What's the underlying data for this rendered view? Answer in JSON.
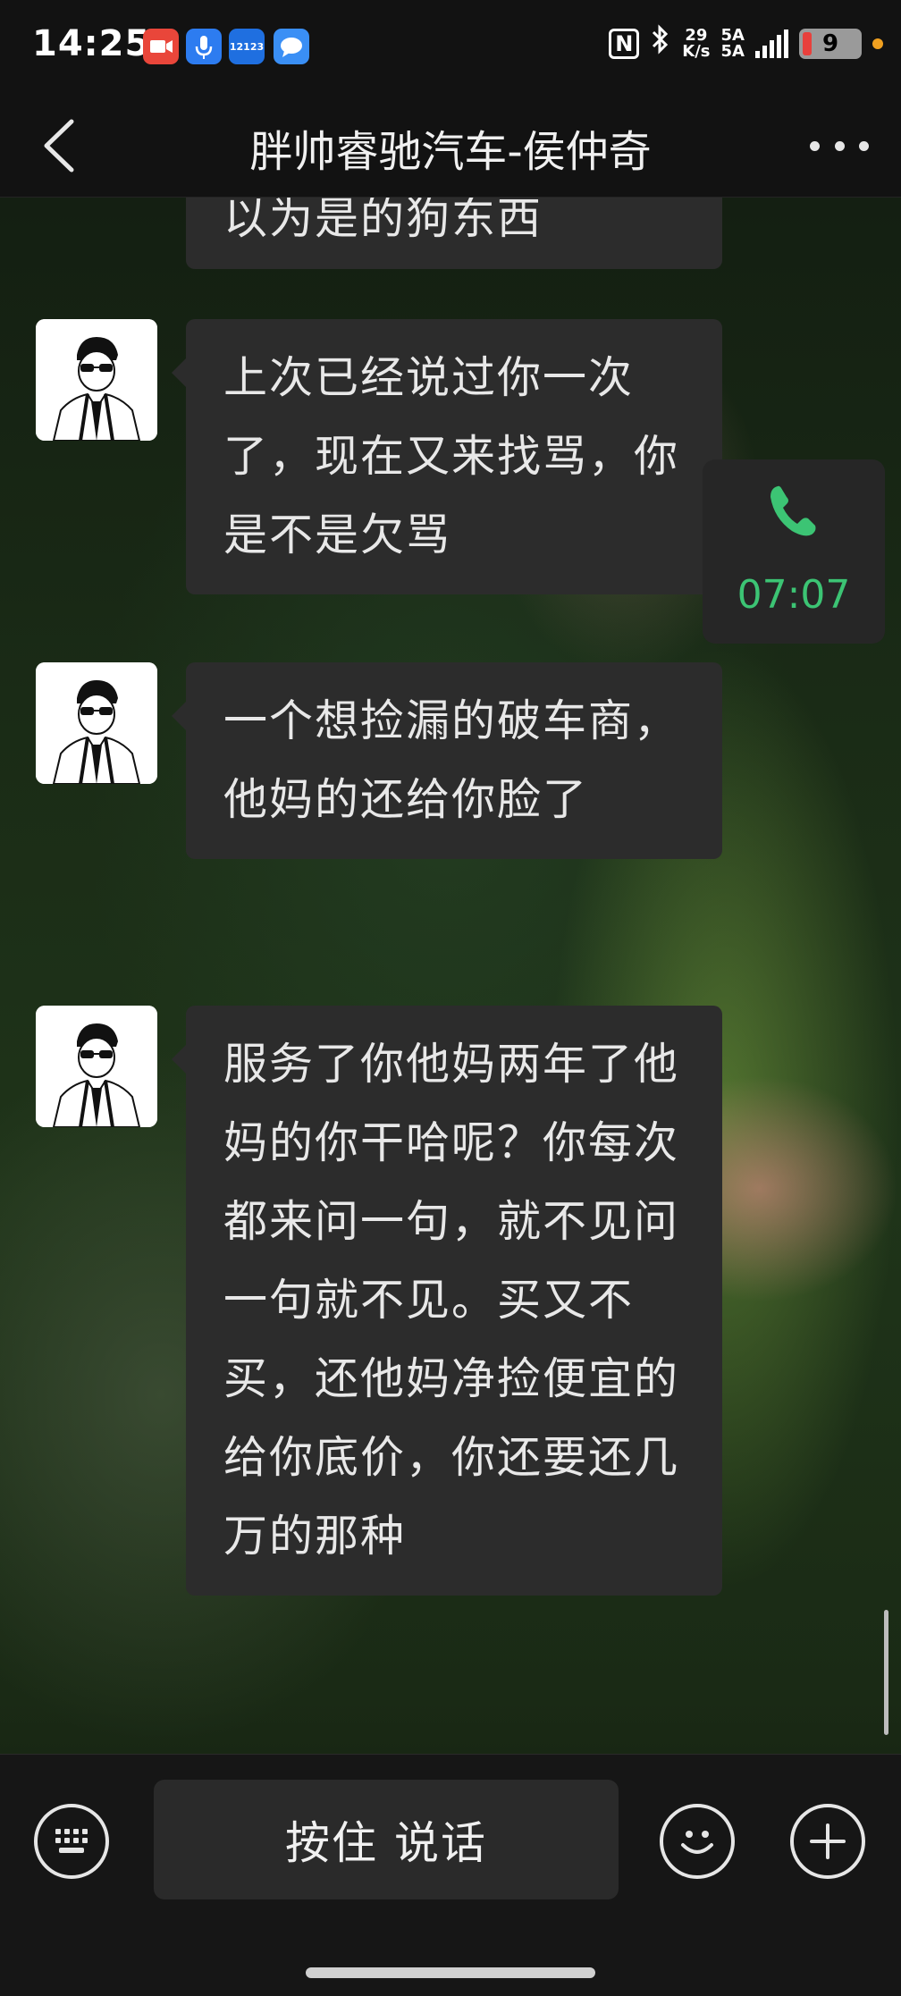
{
  "status_bar": {
    "time": "14:25",
    "nfc_label": "N",
    "net_speed_value": "29",
    "net_speed_unit": "K/s",
    "sim1": "5A",
    "sim2": "5A",
    "battery_level": "9",
    "app_icons": [
      "video-app-icon",
      "voice-app-icon",
      "traffic-12123-icon",
      "chat-bubble-icon"
    ],
    "app_icon_text_12123": "12123"
  },
  "nav": {
    "title": "胖帅睿驰汽车-侯仲奇"
  },
  "messages": [
    {
      "id": "m0",
      "text": "以为是的狗东西"
    },
    {
      "id": "m1",
      "text": "上次已经说过你一次了，现在又来找骂，你是不是欠骂"
    },
    {
      "id": "m2",
      "text": "一个想捡漏的破车商，他妈的还给你脸了"
    },
    {
      "id": "m3",
      "text": "服务了你他妈两年了他妈的你干哈呢？你每次都来问一句，就不见问一句就不见。买又不买，还他妈净捡便宜的给你底价，你还要还几万的那种"
    }
  ],
  "call_record": {
    "duration": "07:07"
  },
  "input_bar": {
    "hold_to_talk_label": "按住 说话"
  },
  "colors": {
    "accent_green": "#3cc474",
    "bubble_bg": "#2c2c2c"
  }
}
